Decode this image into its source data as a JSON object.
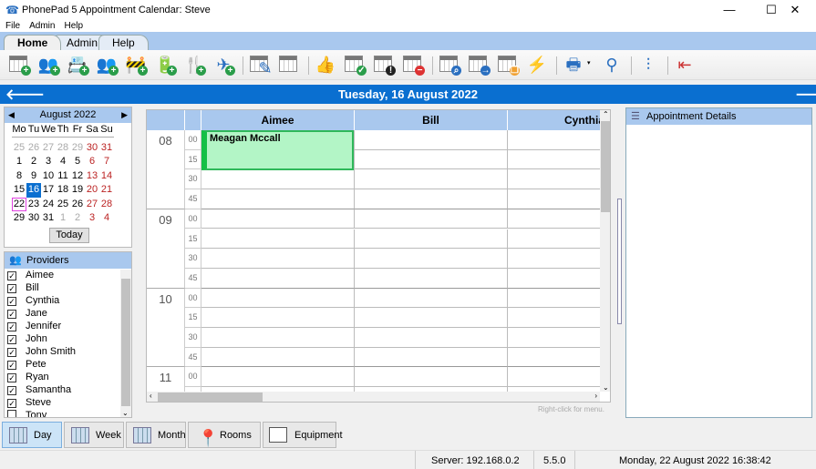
{
  "window": {
    "title": "PhonePad 5 Appointment Calendar: Steve",
    "minimize": "—",
    "maximize": "☐",
    "close": "✕"
  },
  "menu": [
    "File",
    "Admin",
    "Help"
  ],
  "ribbon_tabs": [
    {
      "label": "Home",
      "active": true
    },
    {
      "label": "Admin"
    },
    {
      "label": "Help"
    }
  ],
  "toolbar": [
    {
      "icon": "new-appointment-icon",
      "type": "cal",
      "badge": "+",
      "color": "#2a9d4a"
    },
    {
      "icon": "add-customer-icon",
      "glyph": "👥",
      "badge": "+",
      "color": "#2a9d4a"
    },
    {
      "icon": "add-contact-card-icon",
      "glyph": "📇",
      "badge": "+",
      "color": "#2a9d4a"
    },
    {
      "icon": "add-group-icon",
      "glyph": "👥",
      "badge": "+",
      "color": "#2a9d4a"
    },
    {
      "icon": "add-roadblock-icon",
      "glyph": "🚧",
      "badge": "+",
      "color": "#2a9d4a"
    },
    {
      "icon": "add-battery-icon",
      "glyph": "🔋",
      "badge": "+",
      "color": "#2a9d4a"
    },
    {
      "icon": "add-lunch-icon",
      "glyph": "🍴",
      "badge": "+",
      "color": "#2a9d4a"
    },
    {
      "icon": "add-holiday-icon",
      "glyph": "✈",
      "badge": "+",
      "color": "#2a9d4a"
    },
    {
      "sep": true
    },
    {
      "icon": "edit-appointment-icon",
      "type": "cal",
      "glyph2": "✎"
    },
    {
      "icon": "calendar-icon",
      "type": "cal"
    },
    {
      "sep": true
    },
    {
      "icon": "thumbs-up-icon",
      "glyph": "👍"
    },
    {
      "icon": "confirm-appointment-icon",
      "type": "cal",
      "badge": "✓",
      "color": "#2a9d4a"
    },
    {
      "icon": "appointment-alert-icon",
      "type": "cal",
      "badge": "!",
      "color": "#222"
    },
    {
      "icon": "cancel-appointment-icon",
      "type": "cal",
      "badge": "−",
      "color": "#d33"
    },
    {
      "sep": true
    },
    {
      "icon": "find-appointment-icon",
      "type": "cal",
      "badge": "⌕",
      "color": "#2a6fc0"
    },
    {
      "icon": "move-appointment-icon",
      "type": "cal",
      "badge": "→",
      "color": "#2a6fc0"
    },
    {
      "icon": "copy-appointment-icon",
      "type": "cal",
      "badge": "❐",
      "color": "#f0a030"
    },
    {
      "icon": "lightning-icon",
      "glyph": "⚡"
    },
    {
      "sep": true
    },
    {
      "icon": "print-icon",
      "glyph": "🖶",
      "dropdown": true
    },
    {
      "icon": "search-icon",
      "glyph": "⚲"
    },
    {
      "sep": true
    },
    {
      "icon": "settings-sliders-icon",
      "glyph": "⫶"
    },
    {
      "sep": true
    },
    {
      "icon": "exit-icon",
      "glyph": "⇤"
    }
  ],
  "date_bar": {
    "date": "Tuesday, 16 August 2022",
    "prev": "🡐",
    "next": "🡒"
  },
  "mini_calendar": {
    "month": "August 2022",
    "days_of_week": [
      "Mo",
      "Tu",
      "We",
      "Th",
      "Fr",
      "Sa",
      "Su"
    ],
    "weeks": [
      [
        "25",
        "26",
        "27",
        "28",
        "29",
        "30",
        "31"
      ],
      [
        "1",
        "2",
        "3",
        "4",
        "5",
        "6",
        "7"
      ],
      [
        "8",
        "9",
        "10",
        "11",
        "12",
        "13",
        "14"
      ],
      [
        "15",
        "16",
        "17",
        "18",
        "19",
        "20",
        "21"
      ],
      [
        "22",
        "23",
        "24",
        "25",
        "26",
        "27",
        "28"
      ],
      [
        "29",
        "30",
        "31",
        "1",
        "2",
        "3",
        "4"
      ]
    ],
    "selected": "16",
    "today": "22",
    "today_button": "Today"
  },
  "providers": {
    "title": "Providers",
    "items": [
      {
        "name": "Aimee",
        "checked": true
      },
      {
        "name": "Bill",
        "checked": true
      },
      {
        "name": "Cynthia",
        "checked": true
      },
      {
        "name": "Jane",
        "checked": true
      },
      {
        "name": "Jennifer",
        "checked": true
      },
      {
        "name": "John",
        "checked": true
      },
      {
        "name": "John Smith",
        "checked": true
      },
      {
        "name": "Pete",
        "checked": true
      },
      {
        "name": "Ryan",
        "checked": true
      },
      {
        "name": "Samantha",
        "checked": true
      },
      {
        "name": "Steve",
        "checked": true
      },
      {
        "name": "Tony",
        "checked": false
      }
    ]
  },
  "schedule": {
    "columns": [
      "Aimee",
      "Bill",
      "Cynthia"
    ],
    "hours": [
      "08",
      "09",
      "10",
      "11"
    ],
    "minutes": [
      "00",
      "15",
      "30",
      "45"
    ],
    "appointments": [
      {
        "provider": "Aimee",
        "title": "Meagan Mccall",
        "start": "08:00",
        "end": "08:30",
        "color": "#b3f5c6"
      }
    ],
    "hint": "Right-click for menu."
  },
  "details": {
    "title": "Appointment Details"
  },
  "views": [
    {
      "label": "Day",
      "active": true,
      "icon": "calendar-day-icon"
    },
    {
      "label": "Week",
      "icon": "calendar-week-icon"
    },
    {
      "label": "Month",
      "icon": "calendar-month-icon"
    },
    {
      "label": "Rooms",
      "icon": "map-pin-icon"
    },
    {
      "label": "Equipment",
      "icon": "projector-screen-icon"
    }
  ],
  "status": {
    "server": "Server: 192.168.0.2",
    "version": "5.5.0",
    "datetime": "Monday, 22 August 2022  16:38:42"
  },
  "colors": {
    "accent": "#0a6fd0",
    "header": "#a9c8ee",
    "appointment": "#b3f5c6"
  }
}
